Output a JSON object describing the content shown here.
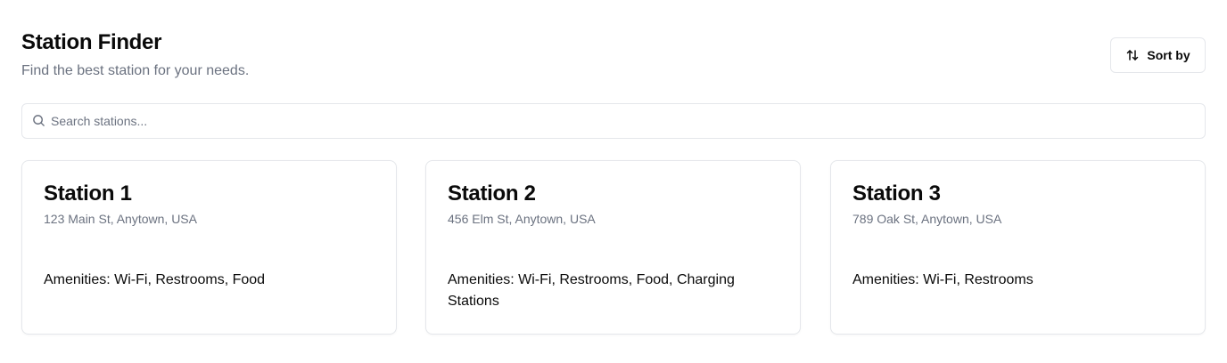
{
  "header": {
    "title": "Station Finder",
    "subtitle": "Find the best station for your needs."
  },
  "toolbar": {
    "sort_label": "Sort by",
    "sort_icon": "arrow-up-down-icon"
  },
  "search": {
    "placeholder": "Search stations...",
    "value": "",
    "icon": "search-icon"
  },
  "stations": [
    {
      "name": "Station 1",
      "address": "123 Main St, Anytown, USA",
      "amenities": "Amenities: Wi-Fi, Restrooms, Food"
    },
    {
      "name": "Station 2",
      "address": "456 Elm St, Anytown, USA",
      "amenities": "Amenities: Wi-Fi, Restrooms, Food, Charging Stations"
    },
    {
      "name": "Station 3",
      "address": "789 Oak St, Anytown, USA",
      "amenities": "Amenities: Wi-Fi, Restrooms"
    }
  ],
  "colors": {
    "text": "#0a0a0a",
    "muted": "#6b7280",
    "border": "#e5e7eb",
    "background": "#ffffff"
  }
}
